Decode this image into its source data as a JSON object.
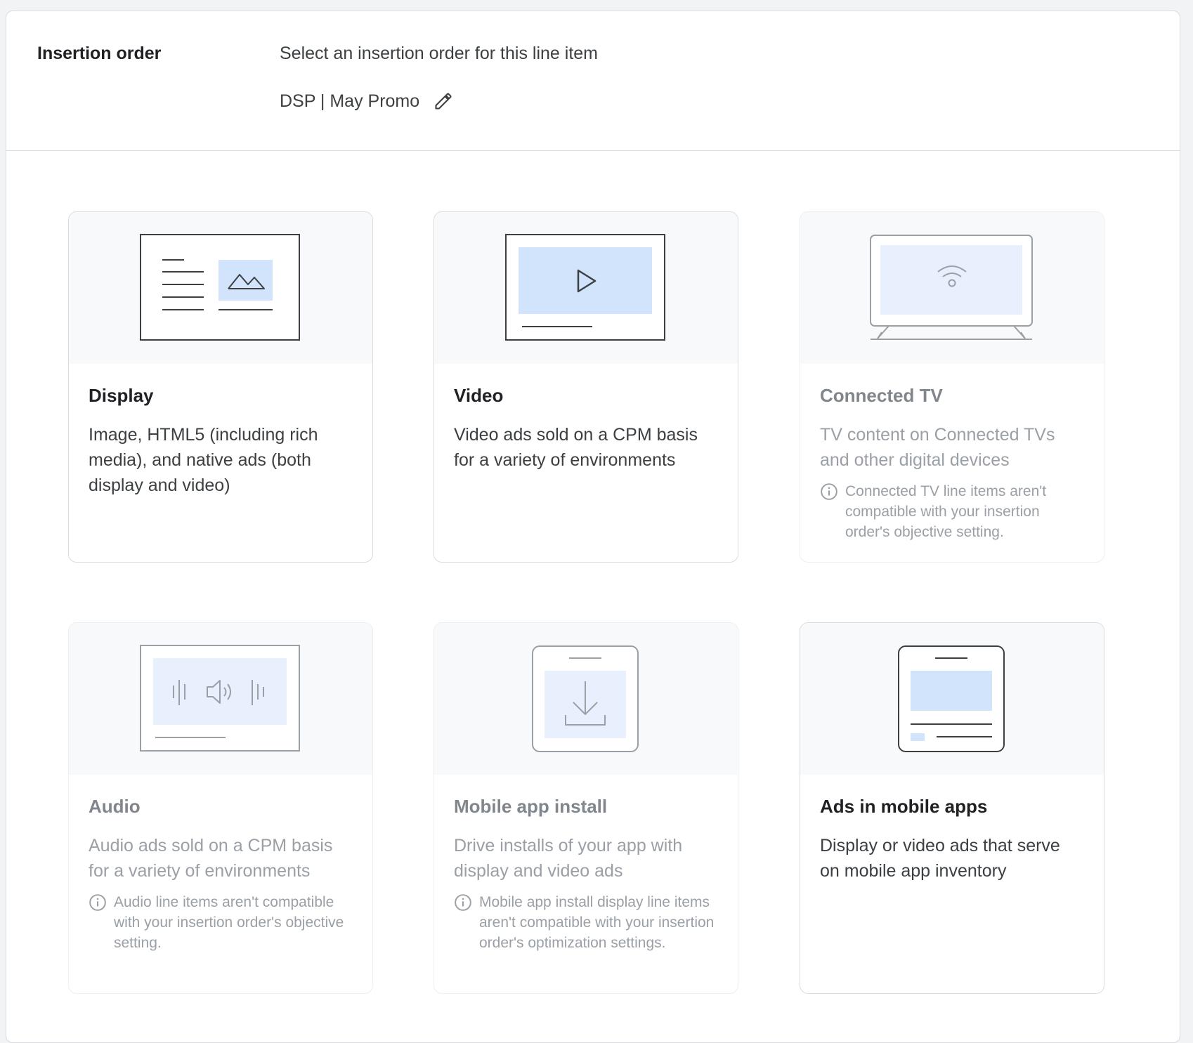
{
  "insertion_order": {
    "label": "Insertion order",
    "prompt": "Select an insertion order for this line item",
    "value": "DSP | May Promo",
    "edit_icon": "pencil-icon"
  },
  "cards": [
    {
      "title": "Display",
      "description": "Image, HTML5 (including rich media), and native ads (both display and video)",
      "enabled": true,
      "icon": "display-ad-illustration"
    },
    {
      "title": "Video",
      "description": "Video ads sold on a CPM basis for a variety of environments",
      "enabled": true,
      "icon": "video-ad-illustration"
    },
    {
      "title": "Connected TV",
      "description": "TV content on Connected TVs and other digital devices",
      "note": "Connected TV line items aren't compatible with your insertion order's objective setting.",
      "enabled": false,
      "icon": "connected-tv-illustration"
    },
    {
      "title": "Audio",
      "description": "Audio ads sold on a CPM basis for a variety of environments",
      "note": "Audio line items aren't compatible with your insertion order's objective setting.",
      "enabled": false,
      "icon": "audio-ad-illustration"
    },
    {
      "title": "Mobile app install",
      "description": "Drive installs of your app with display and video ads",
      "note": "Mobile app install display line items aren't compatible with your insertion order's optimization settings.",
      "enabled": false,
      "icon": "mobile-app-install-illustration"
    },
    {
      "title": "Ads in mobile apps",
      "description": "Display or video ads that serve on mobile app inventory",
      "enabled": true,
      "icon": "mobile-app-ads-illustration"
    }
  ],
  "colors": {
    "accent_fill": "#d2e3fc",
    "accent_fill_light": "#e8f0fe",
    "disabled_text": "#9aa0a6",
    "border": "#dadce0"
  }
}
